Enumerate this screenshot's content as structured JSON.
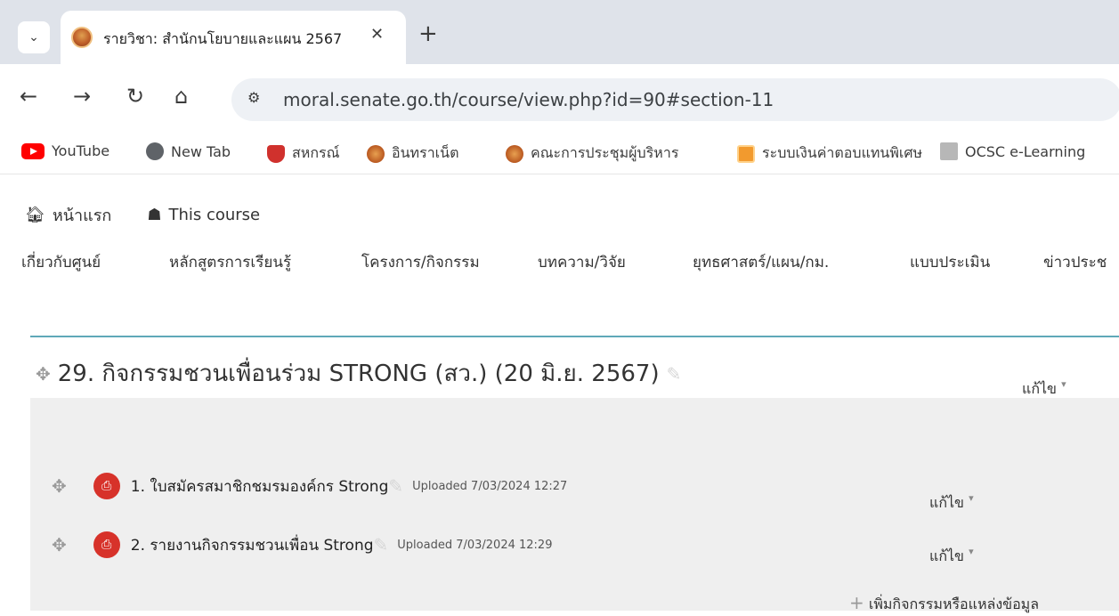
{
  "browser": {
    "tab_title": "รายวิชา: สำนักนโยบายและแผน 2567",
    "url": "moral.senate.go.th/course/view.php?id=90#section-11",
    "bookmarks": [
      {
        "label": "YouTube",
        "icon": "youtube-icon"
      },
      {
        "label": "New Tab",
        "icon": "globe-icon"
      },
      {
        "label": "สหกรณ์",
        "icon": "shield-icon"
      },
      {
        "label": "อินทราเน็ต",
        "icon": "seal-icon"
      },
      {
        "label": "คณะการประชุมผู้บริหาร",
        "icon": "seal-icon"
      },
      {
        "label": "ระบบเงินค่าตอบแทนพิเศษ",
        "icon": "orange-box-icon"
      },
      {
        "label": "OCSC e-Learning",
        "icon": "ocsc-icon"
      }
    ]
  },
  "topnav": {
    "home": "หน้าแรก",
    "this_course": "This course"
  },
  "menu": [
    "เกี่ยวกับศูนย์",
    "หลักสูตรการเรียนรู้",
    "โครงการ/กิจกรรม",
    "บทความ/วิจัย",
    "ยุทธศาสตร์/แผน/กม.",
    "แบบประเมิน",
    "ข่าวประช"
  ],
  "section": {
    "title": "29. กิจกรรมชวนเพื่อนร่วม STRONG (สว.) (20 มิ.ย. 2567)",
    "edit_label": "แก้ไข",
    "activities": [
      {
        "name": "1. ใบสมัครสมาชิกชมรมองค์กร Strong",
        "uploaded": "Uploaded 7/03/2024 12:27",
        "edit_label": "แก้ไข"
      },
      {
        "name": "2. รายงานกิจกรรมชวนเพื่อน Strong",
        "uploaded": "Uploaded 7/03/2024 12:29",
        "edit_label": "แก้ไข"
      }
    ],
    "add_activity": "เพิ่มกิจกรรมหรือแหล่งข้อมูล"
  }
}
